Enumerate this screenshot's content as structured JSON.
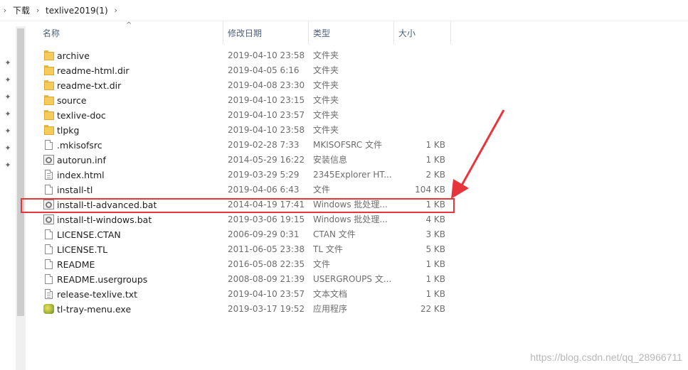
{
  "breadcrumb": [
    "下载",
    "texlive2019(1)"
  ],
  "columns": {
    "name": "名称",
    "date": "修改日期",
    "type": "类型",
    "size": "大小"
  },
  "files": [
    {
      "icon": "folder-icon",
      "name": "archive",
      "date": "2019-04-10 23:58",
      "type": "文件夹",
      "size": ""
    },
    {
      "icon": "folder-icon",
      "name": "readme-html.dir",
      "date": "2019-04-05 6:16",
      "type": "文件夹",
      "size": ""
    },
    {
      "icon": "folder-icon",
      "name": "readme-txt.dir",
      "date": "2019-04-08 23:30",
      "type": "文件夹",
      "size": ""
    },
    {
      "icon": "folder-icon",
      "name": "source",
      "date": "2019-04-10 23:15",
      "type": "文件夹",
      "size": ""
    },
    {
      "icon": "folder-icon",
      "name": "texlive-doc",
      "date": "2019-04-10 23:57",
      "type": "文件夹",
      "size": ""
    },
    {
      "icon": "folder-icon",
      "name": "tlpkg",
      "date": "2019-04-10 23:58",
      "type": "文件夹",
      "size": ""
    },
    {
      "icon": "file-icon",
      "name": ".mkisofsrc",
      "date": "2019-02-28 7:33",
      "type": "MKISOFSRC 文件",
      "size": "1 KB"
    },
    {
      "icon": "settings-file-icon",
      "name": "autorun.inf",
      "date": "2014-05-29 16:22",
      "type": "安装信息",
      "size": "1 KB"
    },
    {
      "icon": "html-file-icon",
      "name": "index.html",
      "date": "2019-03-29 5:29",
      "type": "2345Explorer HT...",
      "size": "2 KB"
    },
    {
      "icon": "file-icon",
      "name": "install-tl",
      "date": "2019-04-06 6:43",
      "type": "文件",
      "size": "104 KB"
    },
    {
      "icon": "batch-file-icon",
      "name": "install-tl-advanced.bat",
      "date": "2014-04-19 17:41",
      "type": "Windows 批处理...",
      "size": "1 KB"
    },
    {
      "icon": "batch-file-icon",
      "name": "install-tl-windows.bat",
      "date": "2019-03-06 19:15",
      "type": "Windows 批处理...",
      "size": "4 KB"
    },
    {
      "icon": "file-icon",
      "name": "LICENSE.CTAN",
      "date": "2006-09-29 0:31",
      "type": "CTAN 文件",
      "size": "3 KB"
    },
    {
      "icon": "file-icon",
      "name": "LICENSE.TL",
      "date": "2011-06-05 23:38",
      "type": "TL 文件",
      "size": "5 KB"
    },
    {
      "icon": "file-icon",
      "name": "README",
      "date": "2016-05-08 22:35",
      "type": "文件",
      "size": "1 KB"
    },
    {
      "icon": "file-icon",
      "name": "README.usergroups",
      "date": "2008-08-09 21:39",
      "type": "USERGROUPS 文...",
      "size": "1 KB"
    },
    {
      "icon": "text-file-icon",
      "name": "release-texlive.txt",
      "date": "2019-04-10 23:57",
      "type": "文本文档",
      "size": "1 KB"
    },
    {
      "icon": "app-icon",
      "name": "tl-tray-menu.exe",
      "date": "2019-03-17 19:52",
      "type": "应用程序",
      "size": "22 KB"
    }
  ],
  "annotation": {
    "color": "#e8353b"
  },
  "watermark": "https://blog.csdn.net/qq_28966711"
}
